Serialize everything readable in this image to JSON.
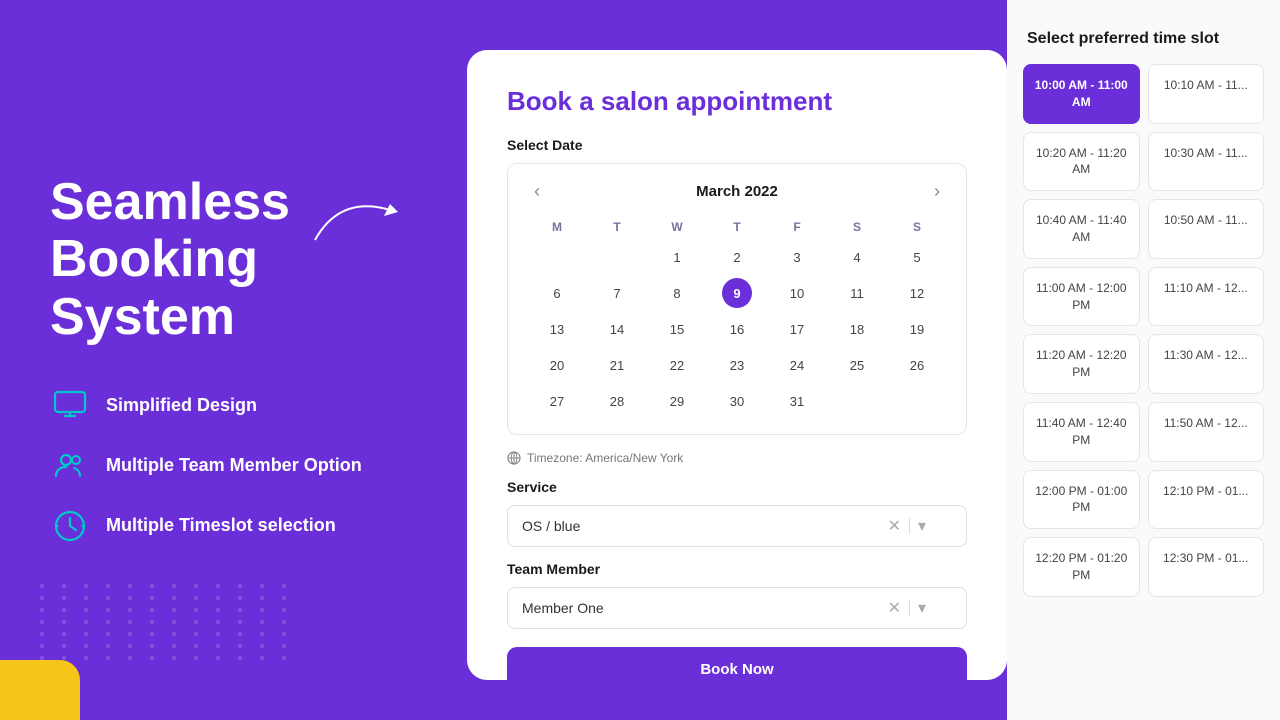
{
  "background": {
    "color": "#6B2FD9"
  },
  "left_panel": {
    "hero_title": "Seamless Booking System",
    "features": [
      {
        "id": "simplified",
        "label": "Simplified Design",
        "icon": "monitor-icon"
      },
      {
        "id": "team",
        "label": "Multiple Team Member Option",
        "icon": "users-icon"
      },
      {
        "id": "timeslot",
        "label": "Multiple Timeslot selection",
        "icon": "clock-icon"
      }
    ]
  },
  "card": {
    "title": "Book a salon appointment",
    "select_date_label": "Select Date",
    "calendar": {
      "month_year": "March 2022",
      "days_of_week": [
        "M",
        "T",
        "W",
        "T",
        "F",
        "S",
        "S"
      ],
      "weeks": [
        [
          "",
          "",
          "1",
          "2",
          "3",
          "4",
          "5"
        ],
        [
          "6",
          "7",
          "8",
          "9",
          "10",
          "11",
          "12"
        ],
        [
          "13",
          "14",
          "15",
          "16",
          "17",
          "18",
          "19"
        ],
        [
          "20",
          "21",
          "22",
          "23",
          "24",
          "25",
          "26"
        ],
        [
          "27",
          "28",
          "29",
          "30",
          "31",
          "",
          ""
        ]
      ],
      "selected_day": "9"
    },
    "timezone_label": "Timezone: America/New York",
    "service_label": "Service",
    "service_value": "OS / blue",
    "team_member_label": "Team Member",
    "team_member_value": "Member One",
    "book_button_label": "Book Now"
  },
  "time_panel": {
    "title": "Select preferred time slot",
    "slots": [
      {
        "id": "s1",
        "label": "10:00 AM - 11:00 AM",
        "active": true
      },
      {
        "id": "s2",
        "label": "10:10 AM - 11...",
        "active": false
      },
      {
        "id": "s3",
        "label": "10:20 AM - 11:20 AM",
        "active": false
      },
      {
        "id": "s4",
        "label": "10:30 AM - 11...",
        "active": false
      },
      {
        "id": "s5",
        "label": "10:40 AM - 11:40 AM",
        "active": false
      },
      {
        "id": "s6",
        "label": "10:50 AM - 11...",
        "active": false
      },
      {
        "id": "s7",
        "label": "11:00 AM - 12:00 PM",
        "active": false
      },
      {
        "id": "s8",
        "label": "11:10 AM - 12...",
        "active": false
      },
      {
        "id": "s9",
        "label": "11:20 AM - 12:20 PM",
        "active": false
      },
      {
        "id": "s10",
        "label": "11:30 AM - 12...",
        "active": false
      },
      {
        "id": "s11",
        "label": "11:40 AM - 12:40 PM",
        "active": false
      },
      {
        "id": "s12",
        "label": "11:50 AM - 12...",
        "active": false
      },
      {
        "id": "s13",
        "label": "12:00 PM - 01:00 PM",
        "active": false
      },
      {
        "id": "s14",
        "label": "12:10 PM - 01...",
        "active": false
      },
      {
        "id": "s15",
        "label": "12:20 PM - 01:20 PM",
        "active": false
      },
      {
        "id": "s16",
        "label": "12:30 PM - 01...",
        "active": false
      }
    ]
  }
}
